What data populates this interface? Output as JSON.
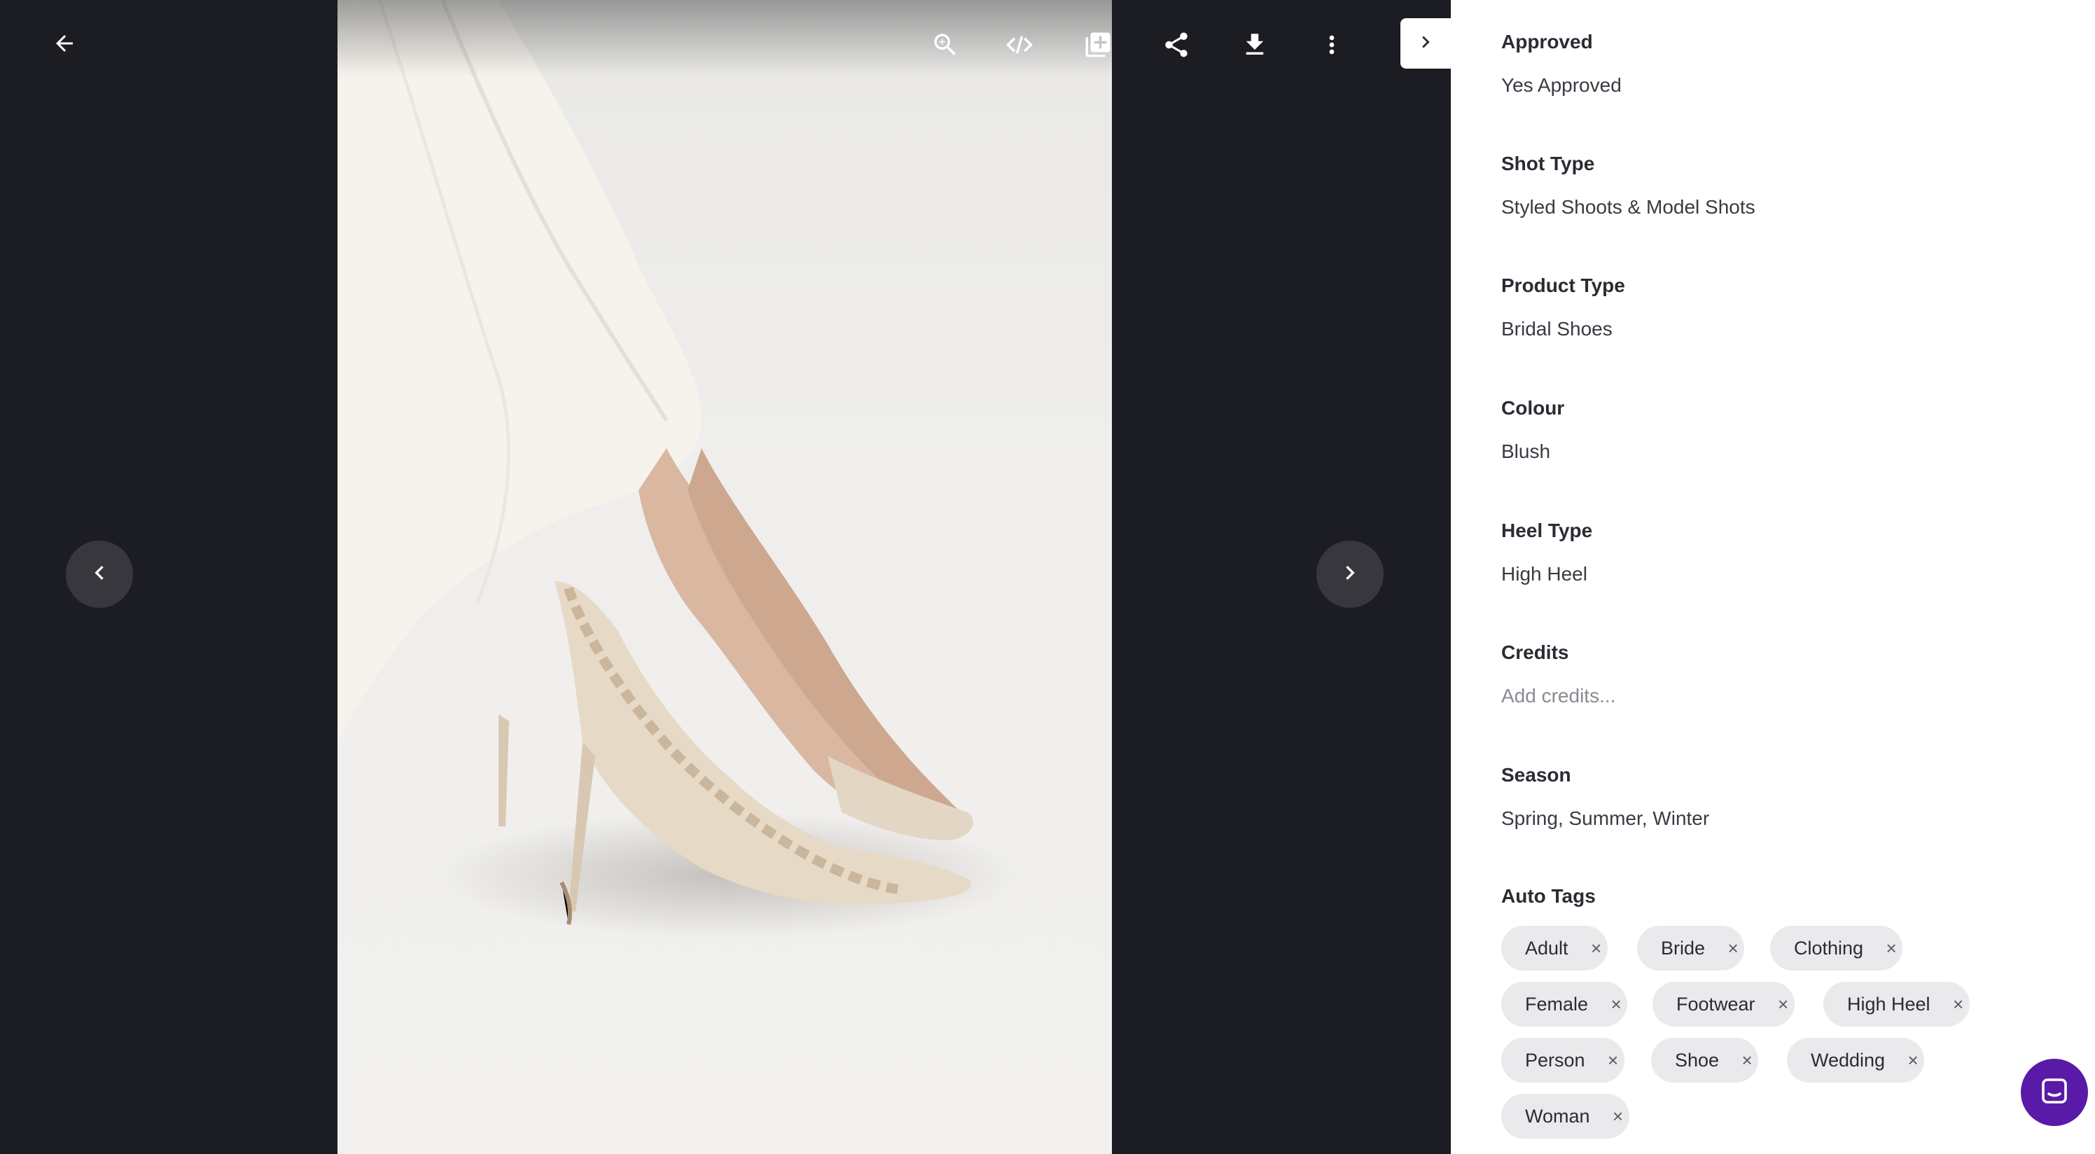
{
  "viewer": {
    "icons": [
      "back-arrow-icon",
      "zoom-in-icon",
      "code-embed-icon",
      "add-to-collection-icon",
      "share-icon",
      "download-icon",
      "more-vertical-icon",
      "chevron-left-icon",
      "chevron-right-icon",
      "chevron-right-icon"
    ],
    "image_alt": "Lace bridal high heel shoe"
  },
  "panel": {
    "fields": [
      {
        "label": "Approved",
        "value": "Yes Approved"
      },
      {
        "label": "Shot Type",
        "value": "Styled Shoots & Model Shots"
      },
      {
        "label": "Product Type",
        "value": "Bridal Shoes"
      },
      {
        "label": "Colour",
        "value": "Blush"
      },
      {
        "label": "Heel Type",
        "value": "High Heel"
      },
      {
        "label": "Credits",
        "placeholder": "Add credits..."
      },
      {
        "label": "Season",
        "value": "Spring, Summer, Winter"
      }
    ],
    "auto_tags_label": "Auto Tags",
    "tags": [
      "Adult",
      "Bride",
      "Clothing",
      "Female",
      "Footwear",
      "High Heel",
      "Person",
      "Shoe",
      "Wedding",
      "Woman"
    ],
    "tag_remove_symbol": "×"
  },
  "colors": {
    "viewer_bg": "#1c1c23",
    "panel_bg": "#ffffff",
    "tag_bg": "#eaeaec",
    "chat_button": "#5a1aa8"
  }
}
